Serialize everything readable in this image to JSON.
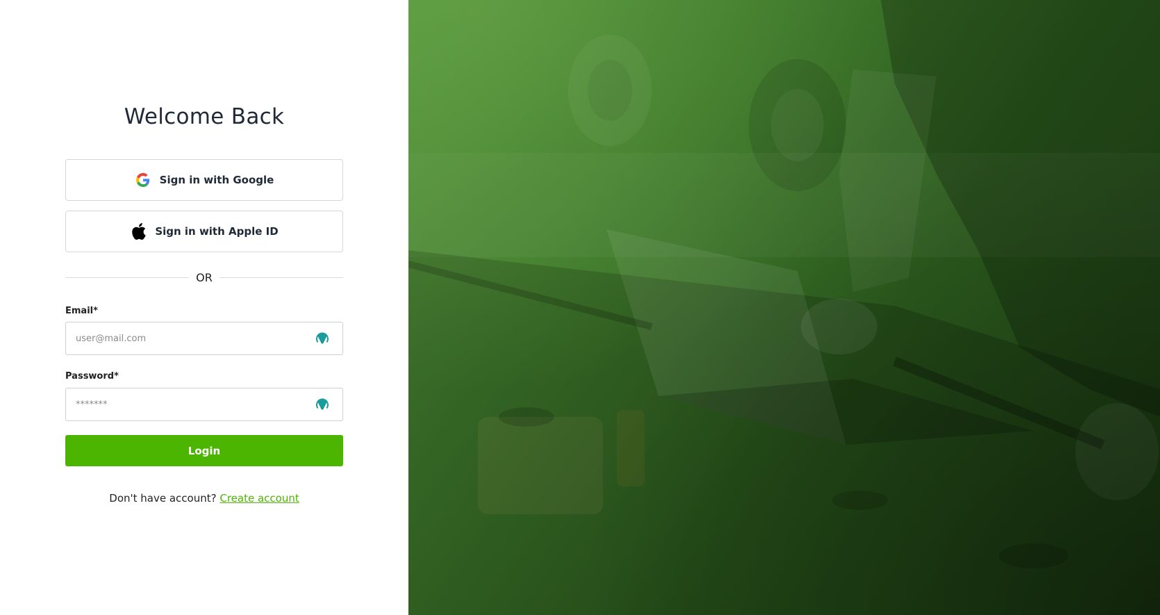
{
  "login": {
    "title": "Welcome Back",
    "google_label": "Sign in with Google",
    "apple_label": "Sign in with Apple ID",
    "divider_text": "OR",
    "email_label": "Email*",
    "email_placeholder": "user@mail.com",
    "password_label": "Password*",
    "password_placeholder": "*******",
    "login_label": "Login",
    "signup_prompt": "Don't have account?",
    "signup_link": "Create account"
  },
  "icons": {
    "google": "google-logo-icon",
    "apple": "apple-logo-icon",
    "password_manager": "password-manager-icon"
  },
  "colors": {
    "accent": "#4cb502",
    "title": "#1f2937",
    "hero_overlay": "#3f7a2c",
    "password_manager_icon": "#1a9c9c"
  },
  "hero": {
    "image": "mechanic-with-laptop-over-car-engine"
  }
}
